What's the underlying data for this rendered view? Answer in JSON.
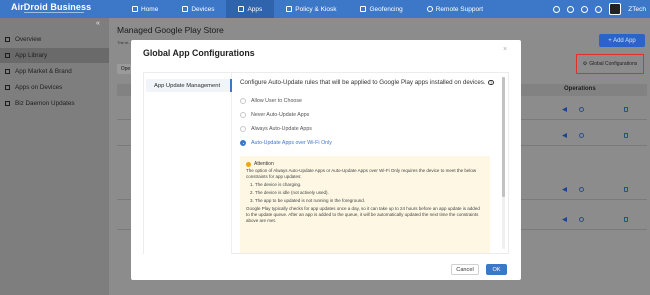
{
  "app": {
    "brand": "AirDroid Business",
    "nav": [
      {
        "label": "Home",
        "icon": "home-icon"
      },
      {
        "label": "Devices",
        "icon": "devices-icon"
      },
      {
        "label": "Apps",
        "icon": "apps-icon",
        "active": true
      },
      {
        "label": "Policy & Kiosk",
        "icon": "policy-icon"
      },
      {
        "label": "Geofencing",
        "icon": "geofencing-icon"
      },
      {
        "label": "Remote Support",
        "icon": "remote-support-icon"
      }
    ],
    "user_name": "ZTech",
    "accent_color": "#3d78c8",
    "danger_color": "#e0302a"
  },
  "sidebar": {
    "collapse_glyph": "«",
    "items": [
      {
        "label": "Overview",
        "icon": "overview-icon"
      },
      {
        "label": "App Library",
        "icon": "app-library-icon",
        "active": true
      },
      {
        "label": "App Market & Brand",
        "icon": "app-market-icon"
      },
      {
        "label": "Apps on Devices",
        "icon": "apps-on-devices-icon"
      },
      {
        "label": "Biz Daemon Updates",
        "icon": "biz-daemon-icon"
      }
    ]
  },
  "page": {
    "title": "Managed Google Play Store",
    "description": "The m… allows t…",
    "add_app_label": "+ Add App",
    "global_config_label": "Global Configurations",
    "filter_label": "Ope…",
    "operations_header": "Operations"
  },
  "modal": {
    "title": "Global App Configurations",
    "close_glyph": "×",
    "menu_item": "App Update Management",
    "intro": "Configure Auto-Update rules that will be applied to Google Play apps installed on devices.",
    "help_glyph": "?",
    "options": [
      {
        "label": "Allow User to Choose",
        "selected": false
      },
      {
        "label": "Never Auto-Update Apps",
        "selected": false
      },
      {
        "label": "Always Auto-Update Apps",
        "selected": false
      },
      {
        "label": "Auto-Update Apps over Wi-Fi Only",
        "selected": true
      }
    ],
    "attention": {
      "title": "Attention",
      "paragraph1": "The option of Always Auto-Update Apps or Auto-Update Apps over Wi-Fi Only requires the device to meet the below constraints for app updates:",
      "constraints": [
        "1. The device is charging.",
        "2. The device is idle (not actively used).",
        "3. The app to be updated is not running in the foreground."
      ],
      "paragraph2": "Google Play typically checks for app updates once a day, so it can take up to 24 hours before an app update is added to the update queue. After an app is added to the queue, it will be automatically updated the next time the constraints above are met."
    },
    "cancel_label": "Cancel",
    "ok_label": "OK"
  }
}
